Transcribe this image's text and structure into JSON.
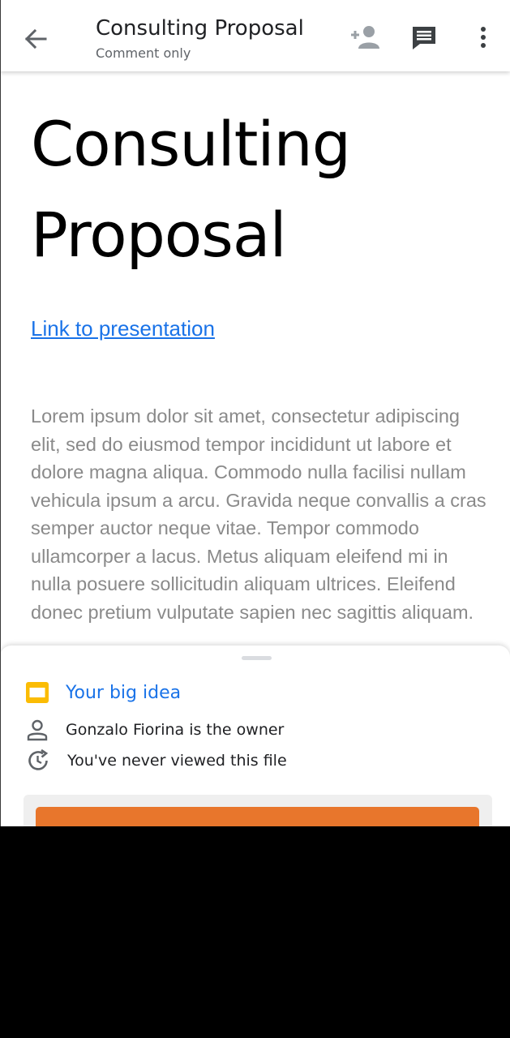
{
  "appbar": {
    "title": "Consulting Proposal",
    "subtitle": "Comment only",
    "icons": {
      "back": "arrow-back-icon",
      "share": "add-person-icon",
      "comment": "comment-icon",
      "more": "more-vert-icon"
    }
  },
  "document": {
    "title_line1": "Consulting",
    "title_line2": "Proposal",
    "link_text": "Link to presentation",
    "body": "Lorem ipsum dolor sit amet, consectetur adipiscing elit, sed do eiusmod tempor incididunt ut labore et dolore magna aliqua. Commodo nulla facilisi nullam vehicula ipsum a arcu. Gravida neque convallis a cras semper auctor neque vitae. Tempor commodo ullamcorper a lacus. Metus aliquam eleifend mi in nulla posuere sollicitudin aliquam ultrices. Eleifend donec pretium vulputate sapien nec sagittis aliquam."
  },
  "sheet": {
    "file_name": "Your big idea",
    "owner_text": "Gonzalo Fiorina is the owner",
    "viewed_text": "You've never viewed this file",
    "icons": {
      "file": "slides-icon",
      "owner": "person-icon",
      "viewed": "history-icon"
    }
  },
  "colors": {
    "link": "#1a73e8",
    "slides_icon": "#fbbc04",
    "primary_button": "#e8762c",
    "body_text": "#8a8a8a"
  }
}
